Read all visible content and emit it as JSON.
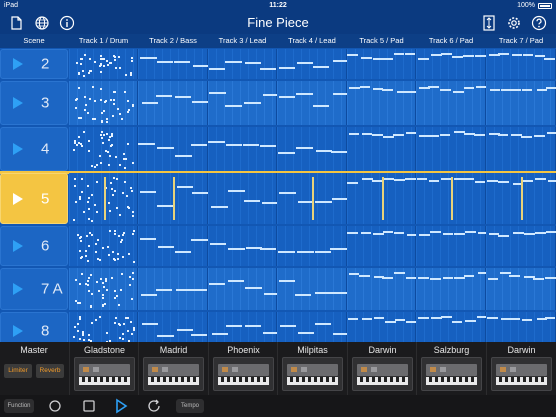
{
  "status_bar": {
    "device": "iPad",
    "time": "11:22",
    "battery": "100%"
  },
  "nav": {
    "title": "Fine Piece",
    "left_icons": [
      "document-icon",
      "globe-icon",
      "info-icon"
    ],
    "right_icons": [
      "resize-icon",
      "gear-icon",
      "help-icon"
    ]
  },
  "columns": {
    "scene": "Scene",
    "tracks": [
      "Track 1 / Drum",
      "Track 2 / Bass",
      "Track 3 / Lead",
      "Track 4 / Lead",
      "Track 5 / Pad",
      "Track 6 / Pad",
      "Track 7 / Pad"
    ]
  },
  "scenes": [
    {
      "label": "2",
      "active": false
    },
    {
      "label": "3",
      "active": false
    },
    {
      "label": "4",
      "active": false
    },
    {
      "label": "5",
      "active": true
    },
    {
      "label": "6",
      "active": false
    },
    {
      "label": "7 A",
      "active": false
    },
    {
      "label": "8",
      "active": false
    }
  ],
  "master": {
    "label": "Master",
    "fx": [
      "Limiter",
      "Reverb"
    ]
  },
  "instruments": [
    "Gladstone",
    "Madrid",
    "Phoenix",
    "Milpitas",
    "Darwin",
    "Salzburg",
    "Darwin"
  ],
  "transport": {
    "function_label": "Function",
    "tempo_label": "Tempo"
  },
  "colors": {
    "accent": "#f4c542",
    "play": "#2ea0f5",
    "grid": "#1660c0",
    "note": "#cfe8ff"
  }
}
